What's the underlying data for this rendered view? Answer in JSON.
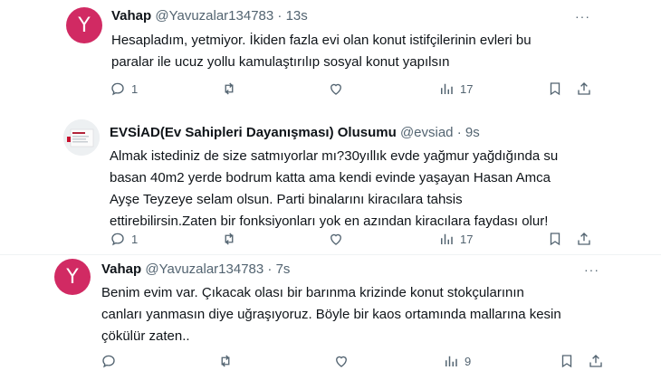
{
  "tweets": [
    {
      "avatar_letter": "Y",
      "name": "Vahap",
      "handle": "@Yavuzalar134783",
      "time": "· 13s",
      "more": "···",
      "lines": [
        "Hesapladım, yetmiyor. İkiden fazla evi olan konut istifçilerinin evleri bu",
        "paralar ile ucuz yollu kamulaştırılıp sosyal konut yapılsın"
      ],
      "replies": "1",
      "views": "17"
    },
    {
      "avatar_letter": "",
      "name": "EVSİAD(Ev Sahipleri Dayanışması) Olusumu",
      "handle": "@evsiad",
      "time": "· 9s",
      "lines": [
        "Almak istediniz de size satmıyorlar mı?30yıllık evde yağmur yağdığında su",
        "basan 40m2 yerde bodrum katta ama kendi evinde yaşayan Hasan Amca",
        "Ayşe Teyzeye selam olsun. Parti binalarını kiracılara tahsis",
        "ettirebilirsin.Zaten bir fonksiyonları yok en azından kiracılara faydası olur!"
      ],
      "replies": "1",
      "views": "17"
    },
    {
      "avatar_letter": "Y",
      "name": "Vahap",
      "handle": "@Yavuzalar134783",
      "time": "· 7s",
      "more": "···",
      "lines": [
        "Benim evim var. Çıkacak olası bir barınma krizinde konut stokçularının",
        "canları yanmasın diye uğraşıyoruz. Böyle bir kaos ortamında mallarına kesin",
        "çökülür zaten.."
      ],
      "replies": "",
      "views": "9"
    }
  ],
  "colors": {
    "avatar": "#d12a63",
    "text": "#0f1419",
    "muted": "#536471",
    "divider": "#eff3f4"
  },
  "icons": [
    "reply-icon",
    "retweet-icon",
    "like-icon",
    "views-icon",
    "bookmark-icon",
    "share-icon",
    "more-icon"
  ]
}
